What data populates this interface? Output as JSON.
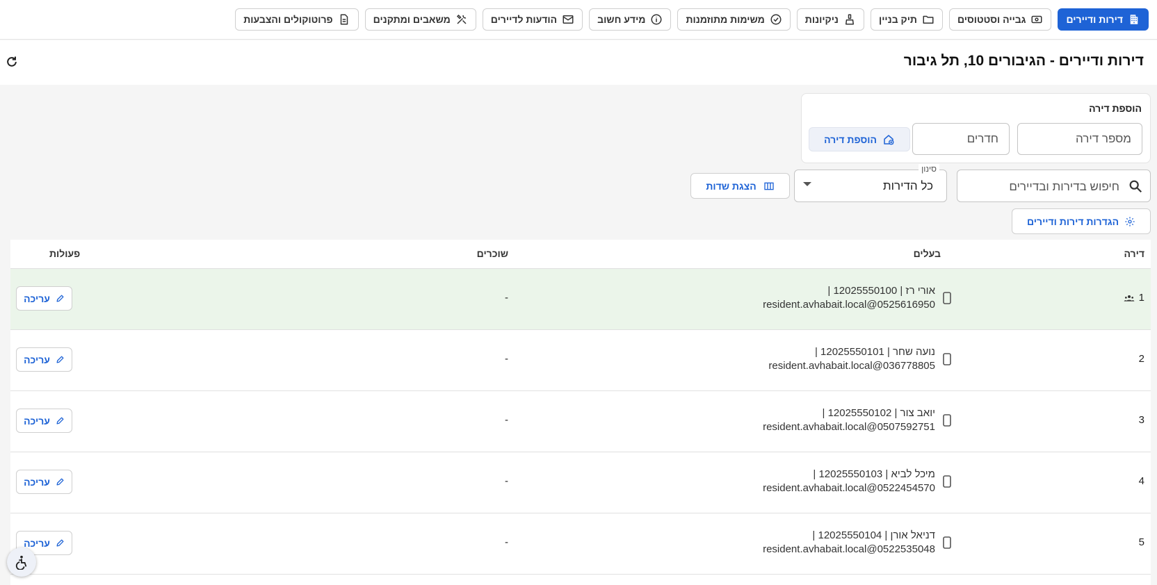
{
  "nav": {
    "items": [
      {
        "label": "דירות ודיירים",
        "icon": "building-icon",
        "active": true
      },
      {
        "label": "גבייה וסטטוסים",
        "icon": "cash-icon",
        "active": false
      },
      {
        "label": "תיק בניין",
        "icon": "folder-icon",
        "active": false
      },
      {
        "label": "ניקיונות",
        "icon": "broom-icon",
        "active": false
      },
      {
        "label": "משימות מתוזמנות",
        "icon": "check-circle-icon",
        "active": false
      },
      {
        "label": "מידע חשוב",
        "icon": "info-icon",
        "active": false
      },
      {
        "label": "הודעות לדיירים",
        "icon": "mail-icon",
        "active": false
      },
      {
        "label": "משאבים ומתקנים",
        "icon": "tools-icon",
        "active": false
      },
      {
        "label": "פרוטוקולים והצבעות",
        "icon": "document-icon",
        "active": false
      }
    ]
  },
  "header": {
    "title": "דירות ודיירים - הגיבורים 10, תל גיבור"
  },
  "add_apartment": {
    "title": "הוספת דירה",
    "apartment_number_placeholder": "מספר דירה",
    "rooms_placeholder": "חדרים",
    "add_button_label": "הוספת דירה"
  },
  "toolbar": {
    "search_placeholder": "חיפוש בדירות ובדיירים",
    "filter_label": "סינון",
    "filter_value": "כל הדירות",
    "show_fields_label": "הצגת שדות",
    "settings_label": "הגדרות דירות ודיירים"
  },
  "table": {
    "headers": {
      "apartment": "דירה",
      "owners": "בעלים",
      "tenants": "שוכרים",
      "actions": "פעולות"
    },
    "edit_label": "עריכה",
    "rows": [
      {
        "apartment": "1",
        "owner_line1": "אורי רז | 12025550100 |",
        "owner_line2": "resident.avhabait.local@0525616950",
        "tenants": "-"
      },
      {
        "apartment": "2",
        "owner_line1": "נועה שחר | 12025550101 |",
        "owner_line2": "resident.avhabait.local@036778805",
        "tenants": "-"
      },
      {
        "apartment": "3",
        "owner_line1": "יואב צור | 12025550102 |",
        "owner_line2": "resident.avhabait.local@0507592751",
        "tenants": "-"
      },
      {
        "apartment": "4",
        "owner_line1": "מיכל לביא | 12025550103 |",
        "owner_line2": "resident.avhabait.local@0522454570",
        "tenants": "-"
      },
      {
        "apartment": "5",
        "owner_line1": "דניאל אורן | 12025550104 |",
        "owner_line2": "resident.avhabait.local@0522535048",
        "tenants": "-"
      }
    ]
  },
  "colors": {
    "primary": "#1e63d6",
    "highlight_row": "#ebf5ea"
  }
}
